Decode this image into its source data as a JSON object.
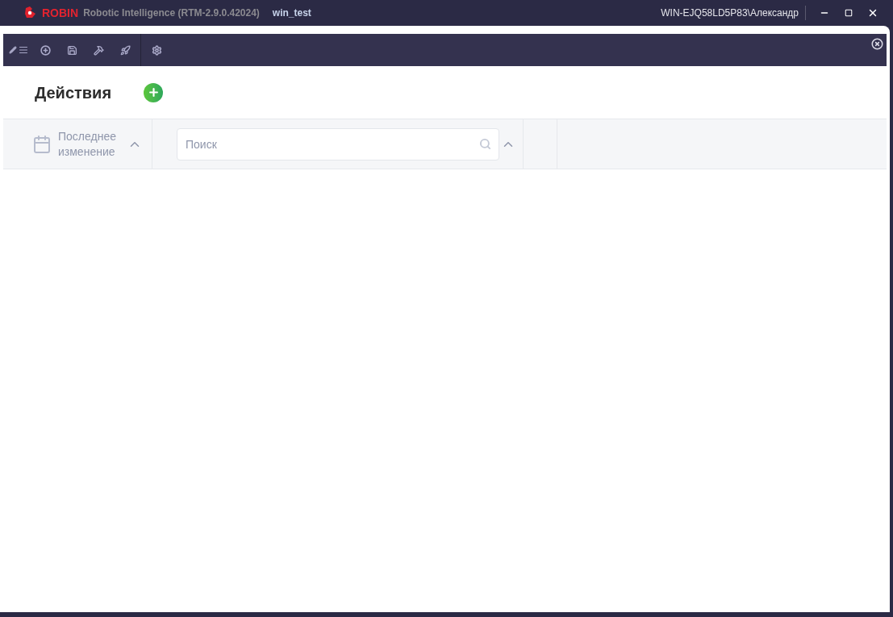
{
  "title_bar": {
    "brand": "ROBIN",
    "app_name": "Robotic Intelligence (RTM-2.9.0.42024)",
    "project": "win_test",
    "user": "WIN-EJQ58LD5P83\\Александр"
  },
  "toolbar": {
    "groups": [
      {
        "kind": "actions"
      },
      {
        "kind": "settings"
      }
    ]
  },
  "page": {
    "title": "Действия"
  },
  "table": {
    "columns": [
      {
        "kind": "sort",
        "label": "Последнее изменение"
      },
      {
        "kind": "search",
        "placeholder": "Поиск"
      },
      {
        "kind": "blank"
      },
      {
        "kind": "blank"
      }
    ]
  }
}
